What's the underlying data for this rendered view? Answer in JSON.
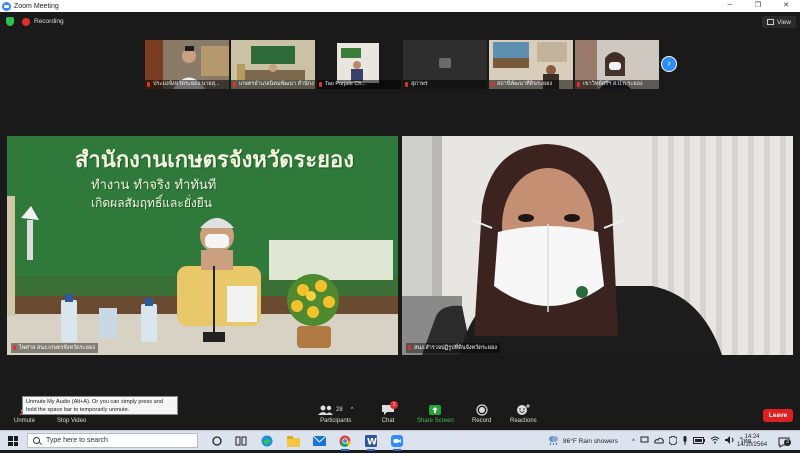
{
  "window": {
    "title": "Zoom Meeting"
  },
  "meeting": {
    "recording_label": "Recording",
    "view_label": "View"
  },
  "thumbnails": [
    {
      "name": "ประมงจังหวัดระยอง นายสุ..."
    },
    {
      "name": "เกษตรอำเภอนิคมพัฒนา สำนักงาน..."
    },
    {
      "name": "Tao Porjate Ch..."
    },
    {
      "name": "สุภาพร"
    },
    {
      "name": "สถานีพัฒนาที่ดินระยอง"
    },
    {
      "name": "เขาวิทย์ศรีฯ ส.ป.ก.ระยอง"
    }
  ],
  "tiles": {
    "left": {
      "name": "ไพศาล สนง.เกษตรจังหวัดระยอง",
      "sign_line1": "สำนักงานเกษตรจังหวัดระยอง",
      "sign_line2": "ทำงาน  ทำจริง  ทำทันที",
      "sign_line3": "เกิดผลสัมฤทธิ์และยั่งยืน"
    },
    "right": {
      "name": "สนง.สำรวจปฏิรูปที่ดินจังหวัดระยอง"
    }
  },
  "tooltip": {
    "text": "Unmute My Audio (Alt+A). Or you can simply press and hold the space bar to temporarily unmute."
  },
  "toolbar": {
    "unmute": "Unmute",
    "stop_video": "Stop Video",
    "participants": "Participants",
    "participants_count": "28",
    "chat": "Chat",
    "chat_badge": "1",
    "share_screen": "Share Screen",
    "record": "Record",
    "reactions": "Reactions",
    "leave": "Leave"
  },
  "taskbar": {
    "search_placeholder": "Type here to search",
    "weather": "86°F  Rain showers",
    "language": "ไทย",
    "time": "14:24",
    "date": "14/10/2564",
    "notification_count": "3"
  },
  "colors": {
    "zoom_blue": "#2d8cff",
    "leave_red": "#e02020",
    "share_green": "#23a33a",
    "sign_green": "#2f7a3b"
  }
}
